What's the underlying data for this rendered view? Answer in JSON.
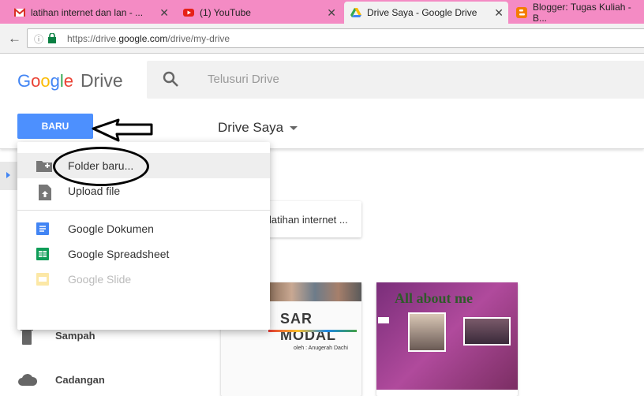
{
  "browser": {
    "tabs": [
      {
        "title": "latihan internet dan lan - ...",
        "favicon": "gmail-icon"
      },
      {
        "title": "(1) YouTube",
        "favicon": "youtube-icon"
      },
      {
        "title": "Drive Saya - Google Drive",
        "favicon": "google-drive-icon"
      },
      {
        "title": "Blogger: Tugas Kuliah - B...",
        "favicon": "blogger-icon"
      }
    ],
    "close_glyph": "✕",
    "url_prefix": "https://drive.",
    "url_host": "google.com",
    "url_path": "/drive/my-drive"
  },
  "header": {
    "logo_drive": "Drive",
    "search_placeholder": "Telusuri Drive",
    "new_button": "BARU",
    "location_title": "Drive Saya"
  },
  "menu": {
    "items": [
      {
        "label": "Folder baru...",
        "icon": "new-folder-icon"
      },
      {
        "label": "Upload file",
        "icon": "upload-file-icon"
      },
      {
        "label": "Google Dokumen",
        "icon": "google-docs-icon"
      },
      {
        "label": "Google Spreadsheet",
        "icon": "google-sheets-icon"
      },
      {
        "label": "Google Slide",
        "icon": "google-slides-icon"
      }
    ]
  },
  "sidebar": {
    "items": [
      {
        "label": "Sampah",
        "icon": "trash-icon"
      },
      {
        "label": "Cadangan",
        "icon": "cloud-icon"
      }
    ]
  },
  "content": {
    "folder_name": "latihan internet ...",
    "doc_title": "SAR MODAL",
    "doc_author": "oleh : Anugerah Dachi",
    "slide_title": "All about me"
  },
  "colors": {
    "tab_strip": "#f48bc4",
    "new_button": "#4d90fe",
    "google_blue": "#4285f4",
    "google_red": "#ea4335",
    "google_yellow": "#fbbc05",
    "google_green": "#34a853"
  }
}
